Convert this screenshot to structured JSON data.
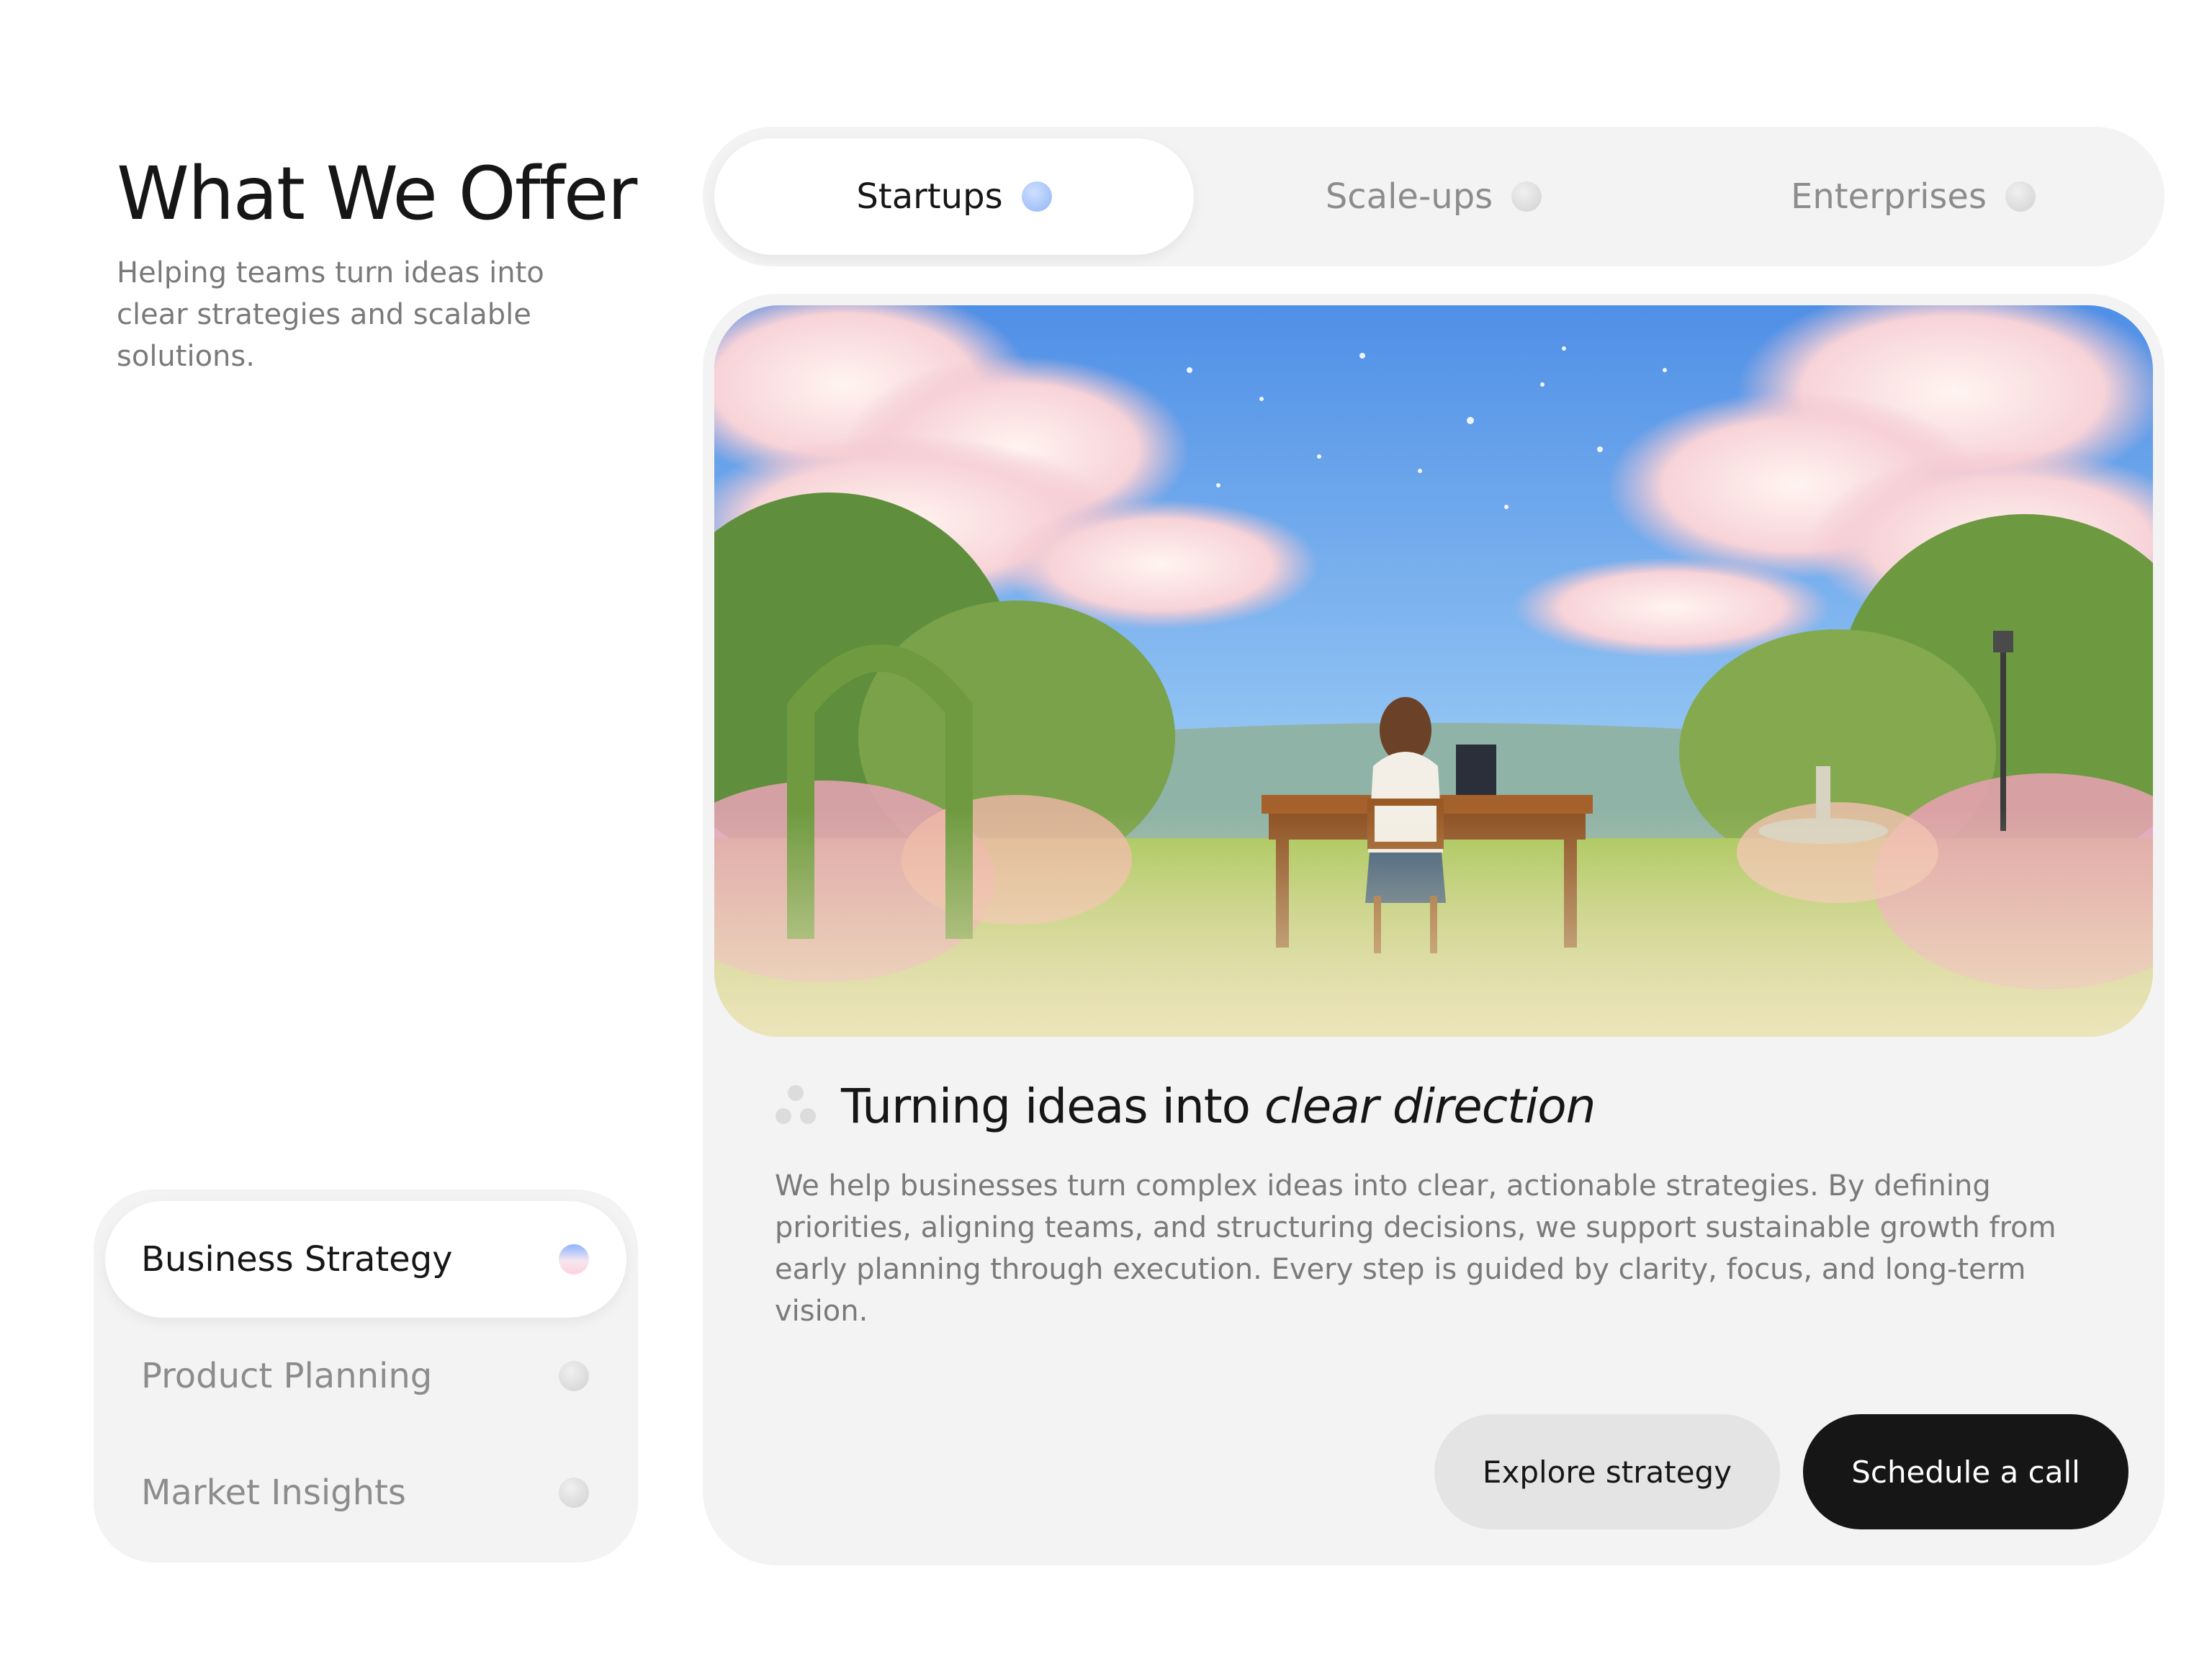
{
  "header": {
    "title": "What We Offer",
    "subtitle": "Helping teams turn ideas into clear strategies and scalable solutions."
  },
  "tabs": [
    {
      "label": "Startups",
      "active": true
    },
    {
      "label": "Scale-ups",
      "active": false
    },
    {
      "label": "Enterprises",
      "active": false
    }
  ],
  "services": [
    {
      "label": "Business Strategy",
      "active": true
    },
    {
      "label": "Product Planning",
      "active": false
    },
    {
      "label": "Market Insights",
      "active": false
    }
  ],
  "card": {
    "heading_plain": "Turning ideas into",
    "heading_emphasis": "clear direction",
    "body": "We help businesses turn complex ideas into clear, actionable strategies. By defining priorities, aligning teams, and structuring decisions, we support sustainable growth from early planning through execution. Every step is guided by clarity, focus, and long-term vision.",
    "explore_label": "Explore strategy",
    "call_label": "Schedule a call"
  },
  "colors": {
    "accent_dark": "#161616",
    "active_tab_dot": "#8fb4f5",
    "muted_text": "#7a7a7a"
  }
}
